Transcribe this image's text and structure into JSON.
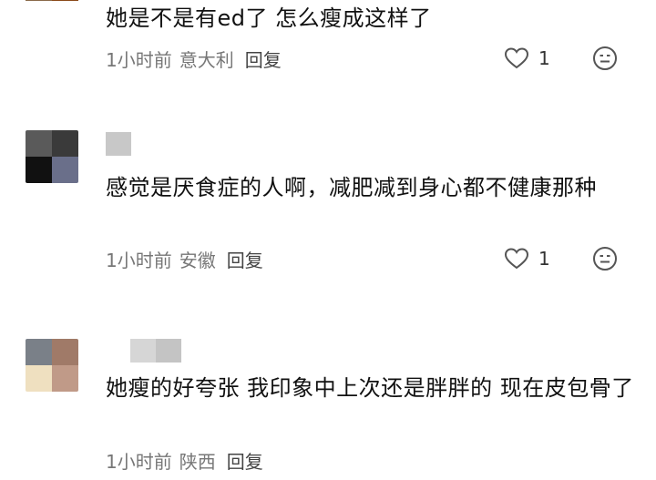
{
  "comments": [
    {
      "text": "她是不是有ed了 怎么瘦成这样了",
      "time": "1小时前",
      "location": "意大利",
      "reply_label": "回复",
      "likes": "1",
      "avatar_colors": [
        "#8a6a4a",
        "#8b4a1a",
        "#ffffff",
        "#ffffff"
      ]
    },
    {
      "text": "感觉是厌食症的人啊，减肥减到身心都不健康那种",
      "time": "1小时前",
      "location": "安徽",
      "reply_label": "回复",
      "likes": "1",
      "avatar_colors": [
        "#5a5a5a",
        "#3a3a3a",
        "#111111",
        "#6a6f8a"
      ],
      "name_blur_colors": [
        "#c8c8c8"
      ]
    },
    {
      "text": "她瘦的好夸张 我印象中上次还是胖胖的 现在皮包骨了",
      "time": "1小时前",
      "location": "陕西",
      "reply_label": "回复",
      "avatar_colors": [
        "#7a8088",
        "#a07a68",
        "#efe0c0",
        "#c09a88"
      ],
      "name_blur_colors": [
        "#d6d6d6",
        "#c4c4c4"
      ]
    }
  ],
  "icons": {
    "like": "heart-outline-icon",
    "emoji": "smiley-face-icon"
  }
}
